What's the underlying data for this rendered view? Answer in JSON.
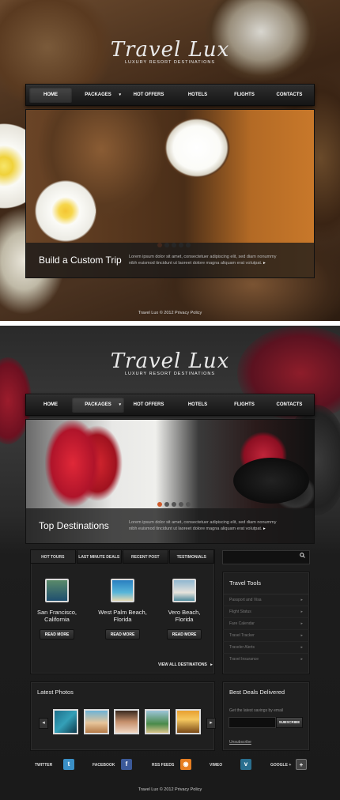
{
  "brand": {
    "name": "Travel Lux",
    "tagline": "LUXURY RESORT DESTINATIONS"
  },
  "nav": {
    "items": [
      "HOME",
      "PACKAGES",
      "HOT OFFERS",
      "HOTELS",
      "FLIGHTS",
      "CONTACTS"
    ],
    "dropdown_arrow": "▾"
  },
  "slider1": {
    "title": "Build a Custom Trip",
    "text": "Lorem ipsum dolor sit amet, consectetuer adipiscing elit, sed diam nonummy nibh euismod tincidunt ut laoreet dolore magna aliquam erat volutpat.",
    "more": "▸"
  },
  "footer": {
    "text": "Travel Lux © 2012 Privacy Policy"
  },
  "slider2": {
    "title": "Top Destinations",
    "text": "Lorem ipsum dolor sit amet, consectetuer adipiscing elit, sed diam nonummy nibh euismod tincidunt ut laoreet dolore magna aliquam erat volutpat."
  },
  "tabs": [
    "HOT TOURS",
    "LAST MINUTE DEALS",
    "RECENT POST",
    "TESTIMONIALS"
  ],
  "destinations": [
    {
      "name_line1": "San Francisco,",
      "name_line2": "California",
      "button": "READ MORE"
    },
    {
      "name_line1": "West Palm Beach,",
      "name_line2": "Florida",
      "button": "READ MORE"
    },
    {
      "name_line1": "Vero Beach,",
      "name_line2": "Florida",
      "button": "READ MORE"
    }
  ],
  "view_all": "VIEW ALL DESTINATIONS",
  "search": {
    "placeholder": "",
    "icon": "search-icon"
  },
  "travel_tools": {
    "title": "Travel Tools",
    "items": [
      "Passport and Visa",
      "Flight Status",
      "Fare Calendar",
      "Travel Tracker",
      "Traveler Alerts",
      "Travel Insurance"
    ]
  },
  "latest_photos": {
    "title": "Latest Photos",
    "prev": "◂",
    "next": "▸"
  },
  "deals": {
    "title": "Best Deals Delivered",
    "subtitle": "Get the latest savings by email",
    "button": "SUBSCRIBE",
    "unsubscribe": "Unsubscribe"
  },
  "social": [
    {
      "label": "TWITTER",
      "icon": "twitter-icon",
      "glyph": "t",
      "color": "#3a8fc6"
    },
    {
      "label": "FACEBOOK",
      "icon": "facebook-icon",
      "glyph": "f",
      "color": "#3b5998"
    },
    {
      "label": "RSS FEEDS",
      "icon": "rss-icon",
      "glyph": "◉",
      "color": "#e67e22"
    },
    {
      "label": "VIMEO",
      "icon": "vimeo-icon",
      "glyph": "v",
      "color": "#2a6f8f"
    },
    {
      "label": "GOOGLE +",
      "icon": "google-plus-icon",
      "glyph": "+",
      "color": "#444444"
    }
  ]
}
